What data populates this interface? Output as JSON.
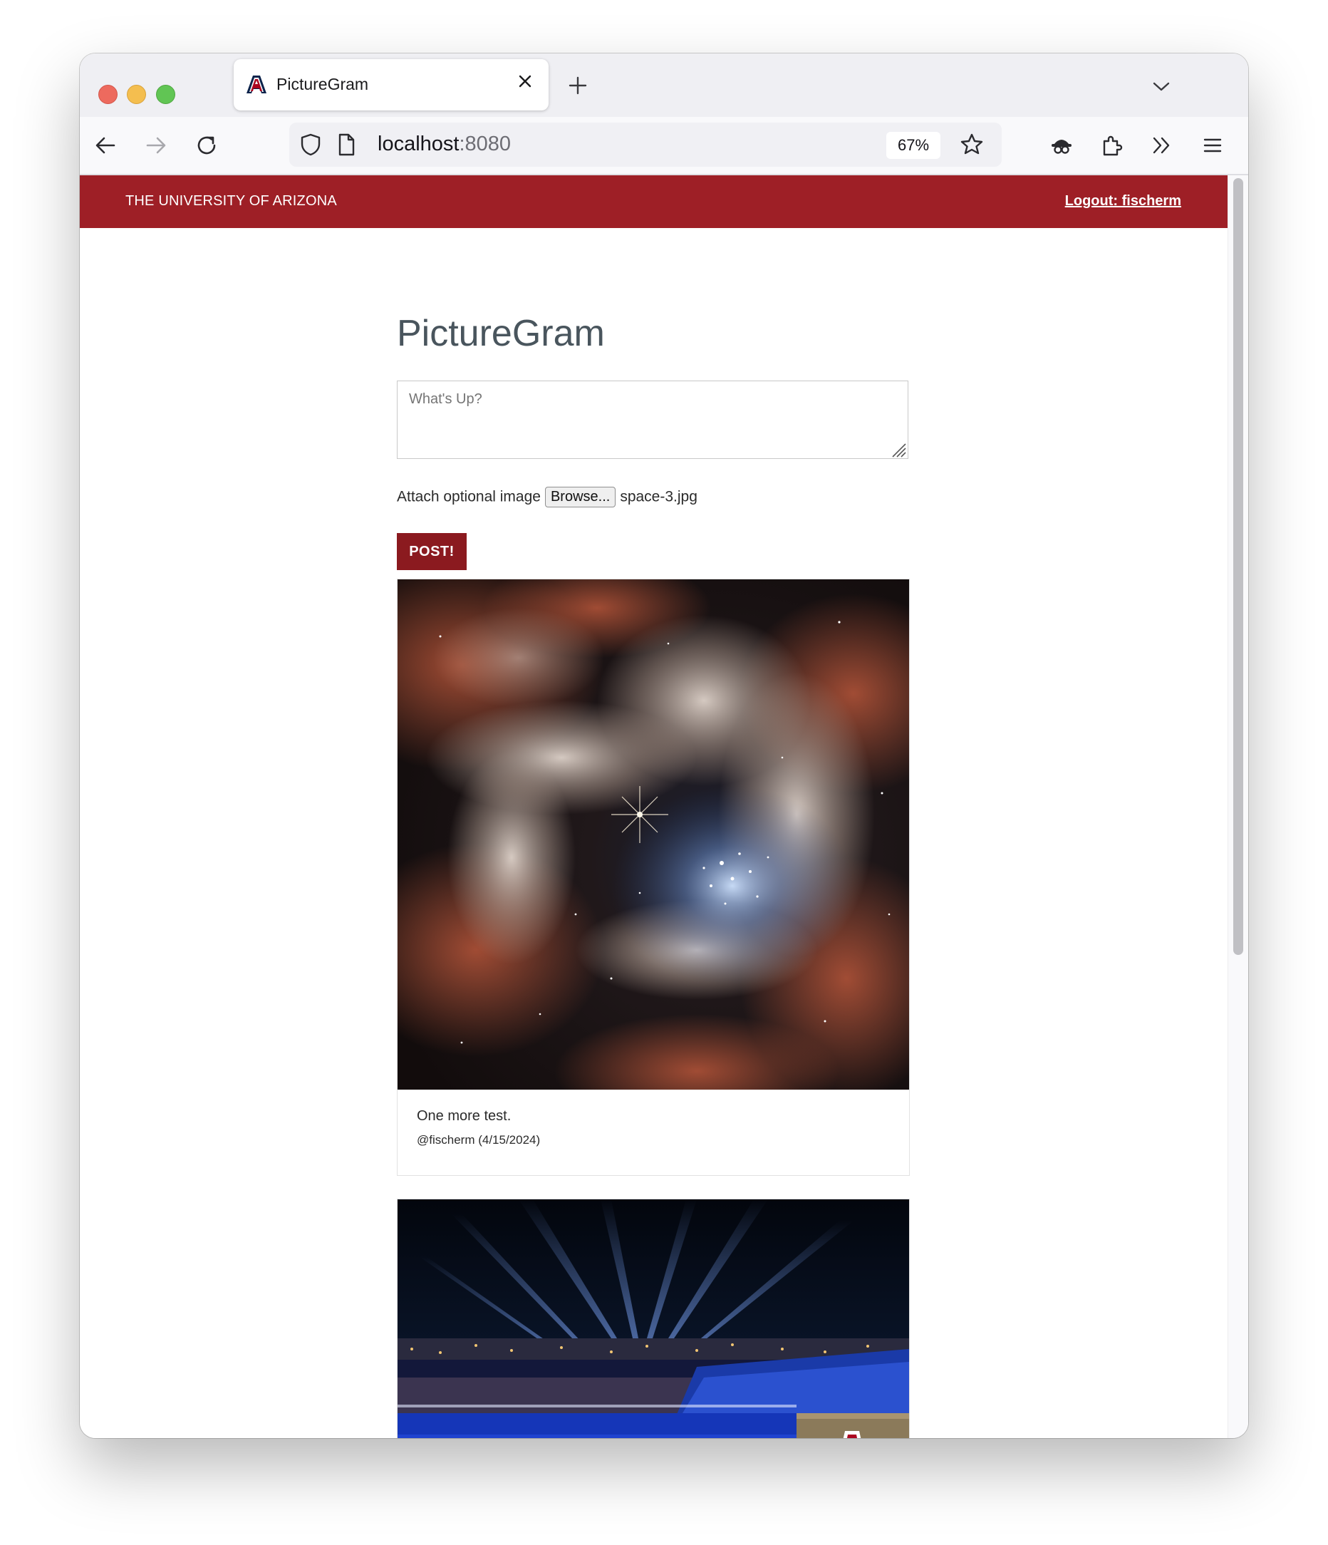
{
  "browser": {
    "tab_title": "PictureGram",
    "url_host": "localhost",
    "url_port": ":8080",
    "zoom": "67%"
  },
  "header": {
    "brand": "THE UNIVERSITY OF ARIZONA",
    "logout": "Logout: fischerm"
  },
  "main": {
    "title": "PictureGram",
    "post_placeholder": "What's Up?",
    "attach_label": "Attach optional image",
    "browse_label": "Browse...",
    "selected_file": "space-3.jpg",
    "post_button": "POST!"
  },
  "posts": [
    {
      "image": "nebula-photo",
      "caption": "One more test.",
      "byline": "@fischerm (4/15/2024)"
    },
    {
      "image": "stadium-night-photo"
    }
  ],
  "colors": {
    "brand_red": "#9e1f26",
    "button_red": "#8b1a1f",
    "title_gray": "#49555d"
  }
}
